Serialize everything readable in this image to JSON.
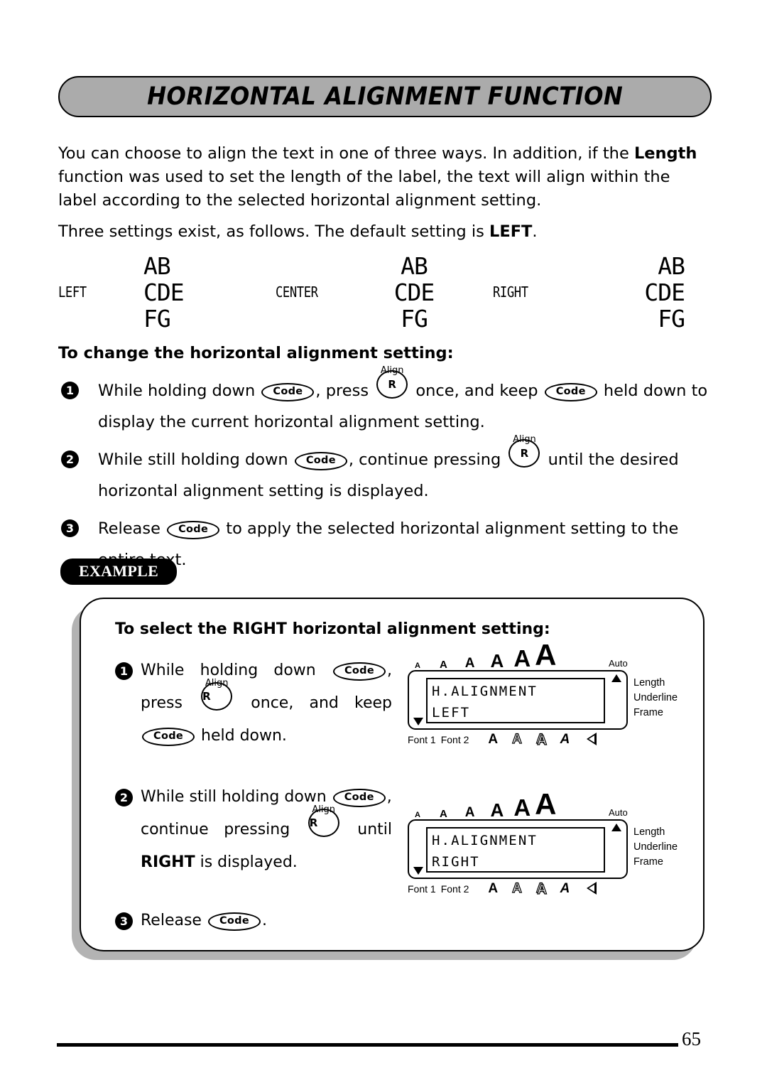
{
  "header": {
    "title": "HORIZONTAL ALIGNMENT FUNCTION"
  },
  "intro": {
    "para1_a": "You can choose to align the text in one of three ways. In addition, if the ",
    "para1_bold": "Length",
    "para1_b": " function was used to set the length of the label, the text will align within the label according to the selected horizontal alignment setting.",
    "para2_a": "Three settings exist, as follows. The default setting is ",
    "para2_bold": "LEFT",
    "para2_b": "."
  },
  "samples": [
    {
      "label": "LEFT",
      "line1": "AB",
      "line2": "CDE",
      "line3": "FG",
      "align": "left"
    },
    {
      "label": "CENTER",
      "line1": "AB",
      "line2": "CDE",
      "line3": "FG",
      "align": "center"
    },
    {
      "label": "RIGHT",
      "line1": "AB",
      "line2": "CDE",
      "line3": "FG",
      "align": "right"
    }
  ],
  "howto": {
    "heading": "To change the horizontal alignment setting:",
    "step1": {
      "num": "1",
      "t1": "While holding down ",
      "key1": "Code",
      "t2": ", press ",
      "key2": "R",
      "key2_sup": "Align",
      "t3": " once, and keep ",
      "key3": "Code",
      "t4": " held down to display the current horizontal alignment setting."
    },
    "step2": {
      "num": "2",
      "t1": "While still holding down ",
      "key1": "Code",
      "t2": ", continue pressing ",
      "key2": "R",
      "key2_sup": "Align",
      "t3": " until the desired horizontal alignment setting is displayed."
    },
    "step3": {
      "num": "3",
      "t1": "Release ",
      "key1": "Code",
      "t2": " to apply the selected horizontal alignment setting to the entire text."
    }
  },
  "example": {
    "badge": "EXAMPLE",
    "heading": "To select the RIGHT horizontal alignment setting:",
    "step1": {
      "num": "1",
      "line1_a": "While holding down ",
      "key1": "Code",
      "line1_b": ",",
      "line2_a": "press ",
      "key2": "R",
      "key2_sup": "Align",
      "line2_b": " once, and keep",
      "key3": "Code",
      "line3_b": " held down."
    },
    "step2": {
      "num": "2",
      "line1_a": "While still holding down ",
      "key1": "Code",
      "line1_b": ",",
      "line2_a": "continue pressing ",
      "key2": "R",
      "key2_sup": "Align",
      "line2_b": " until",
      "line3_bold": "RIGHT",
      "line3_b": " is displayed."
    },
    "step3": {
      "num": "3",
      "t1": "Release ",
      "key1": "Code",
      "t2": "."
    }
  },
  "lcd": {
    "size_glyphs": [
      "A",
      "A",
      "A",
      "A",
      "A",
      "A"
    ],
    "auto_label": "Auto",
    "right_labels": [
      "Length",
      "Underline",
      "Frame"
    ],
    "font1_label": "Font 1",
    "font2_label": "Font 2",
    "style_glyphs": [
      "A",
      "A",
      "A",
      "A"
    ],
    "panel1": {
      "line1": "H.ALIGNMENT",
      "line2": "LEFT"
    },
    "panel2": {
      "line1": "H.ALIGNMENT",
      "line2": "RIGHT"
    }
  },
  "footer": {
    "page_number": "65"
  }
}
